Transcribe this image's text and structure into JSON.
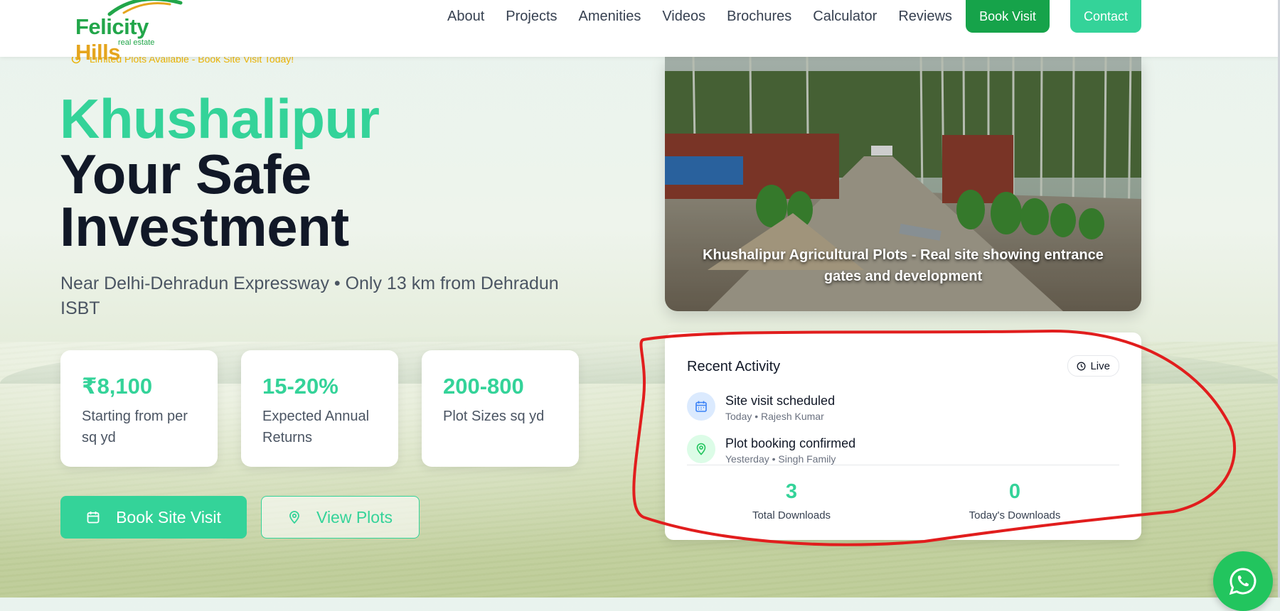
{
  "brand": {
    "name_part1": "Felicity",
    "name_part2": "Hills",
    "tagline": "real estate"
  },
  "nav": {
    "items": [
      {
        "label": "About"
      },
      {
        "label": "Projects"
      },
      {
        "label": "Amenities"
      },
      {
        "label": "Videos"
      },
      {
        "label": "Brochures"
      },
      {
        "label": "Calculator"
      },
      {
        "label": "Reviews"
      }
    ],
    "book_visit_label": "Book Visit",
    "contact_label": "Contact"
  },
  "hero": {
    "banner": "Limited Plots Available - Book Site Visit Today!",
    "title_highlight": "Khushalipur",
    "title_line2": "Your Safe",
    "title_line3": "Investment",
    "subtitle": "Near Delhi-Dehradun Expressway • Only 13 km from Dehradun ISBT",
    "stats": [
      {
        "value": "₹8,100",
        "label": "Starting from per sq yd"
      },
      {
        "value": "15-20%",
        "label": "Expected Annual Returns"
      },
      {
        "value": "200-800",
        "label": "Plot Sizes sq yd"
      }
    ],
    "cta_primary": "Book Site Visit",
    "cta_secondary": "View Plots",
    "photo_caption": "Khushalipur Agricultural Plots - Real site showing entrance gates and development"
  },
  "activity": {
    "title": "Recent Activity",
    "live_label": "Live",
    "items": [
      {
        "text": "Site visit scheduled",
        "meta": "Today • Rajesh Kumar",
        "icon": "calendar-icon"
      },
      {
        "text": "Plot booking confirmed",
        "meta": "Yesterday • Singh Family",
        "icon": "map-pin-icon"
      }
    ],
    "downloads": [
      {
        "value": "3",
        "label": "Total Downloads"
      },
      {
        "value": "0",
        "label": "Today's Downloads"
      }
    ]
  },
  "colors": {
    "primary_green": "#34d399",
    "brand_green": "#22a64a",
    "brand_gold": "#e5a51e",
    "book_button": "#16a34a",
    "annotation_red": "#e11d1d"
  }
}
